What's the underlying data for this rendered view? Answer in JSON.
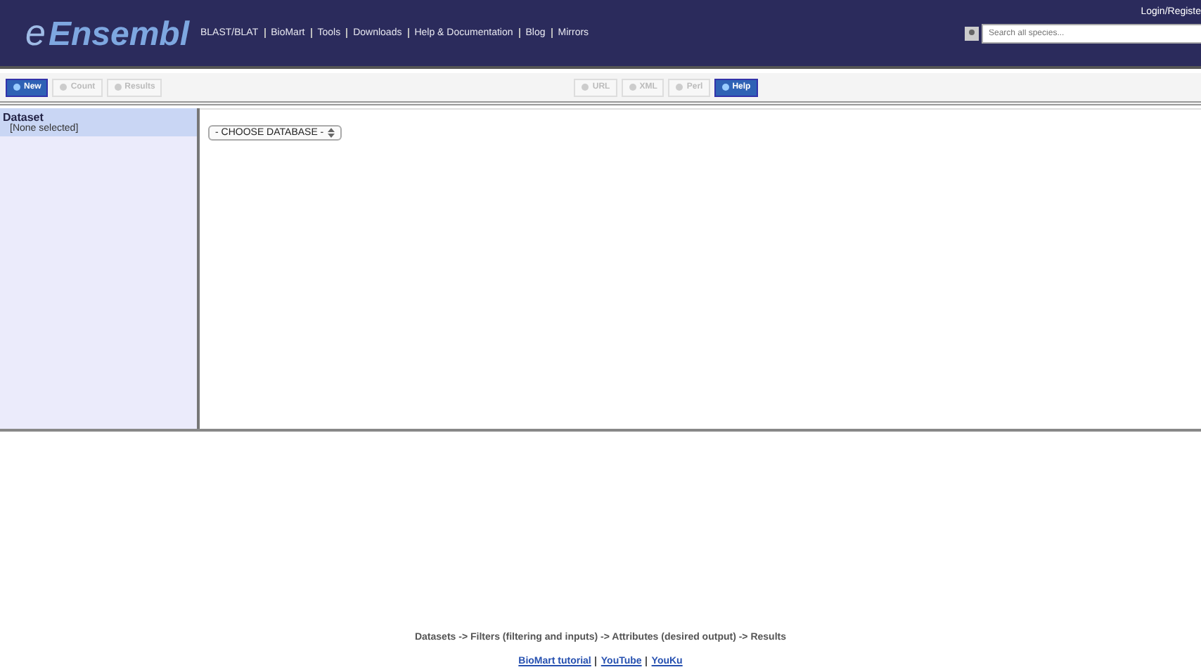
{
  "header": {
    "logo": {
      "prefix": "e",
      "name": "Ensembl"
    },
    "nav": [
      "BLAST/BLAT",
      "BioMart",
      "Tools",
      "Downloads",
      "Help & Documentation",
      "Blog",
      "Mirrors"
    ],
    "login": "Login/Registe",
    "search": {
      "placeholder": "Search all species..."
    }
  },
  "toolbar": {
    "left": [
      {
        "label": "New",
        "disabled": false
      },
      {
        "label": "Count",
        "disabled": true
      },
      {
        "label": "Results",
        "disabled": true
      }
    ],
    "right": [
      {
        "label": "URL",
        "disabled": true
      },
      {
        "label": "XML",
        "disabled": true
      },
      {
        "label": "Perl",
        "disabled": true
      },
      {
        "label": "Help",
        "disabled": false
      }
    ]
  },
  "sidebar": {
    "items": [
      {
        "title": "Dataset",
        "value": "[None selected]",
        "selected": true
      }
    ]
  },
  "database_select": {
    "value": "- CHOOSE DATABASE -"
  },
  "footer": {
    "steps": "Datasets -> Filters (filtering and inputs) -> Attributes (desired output) -> Results",
    "links": [
      "BioMart tutorial",
      "YouTube",
      "YouKu"
    ]
  }
}
